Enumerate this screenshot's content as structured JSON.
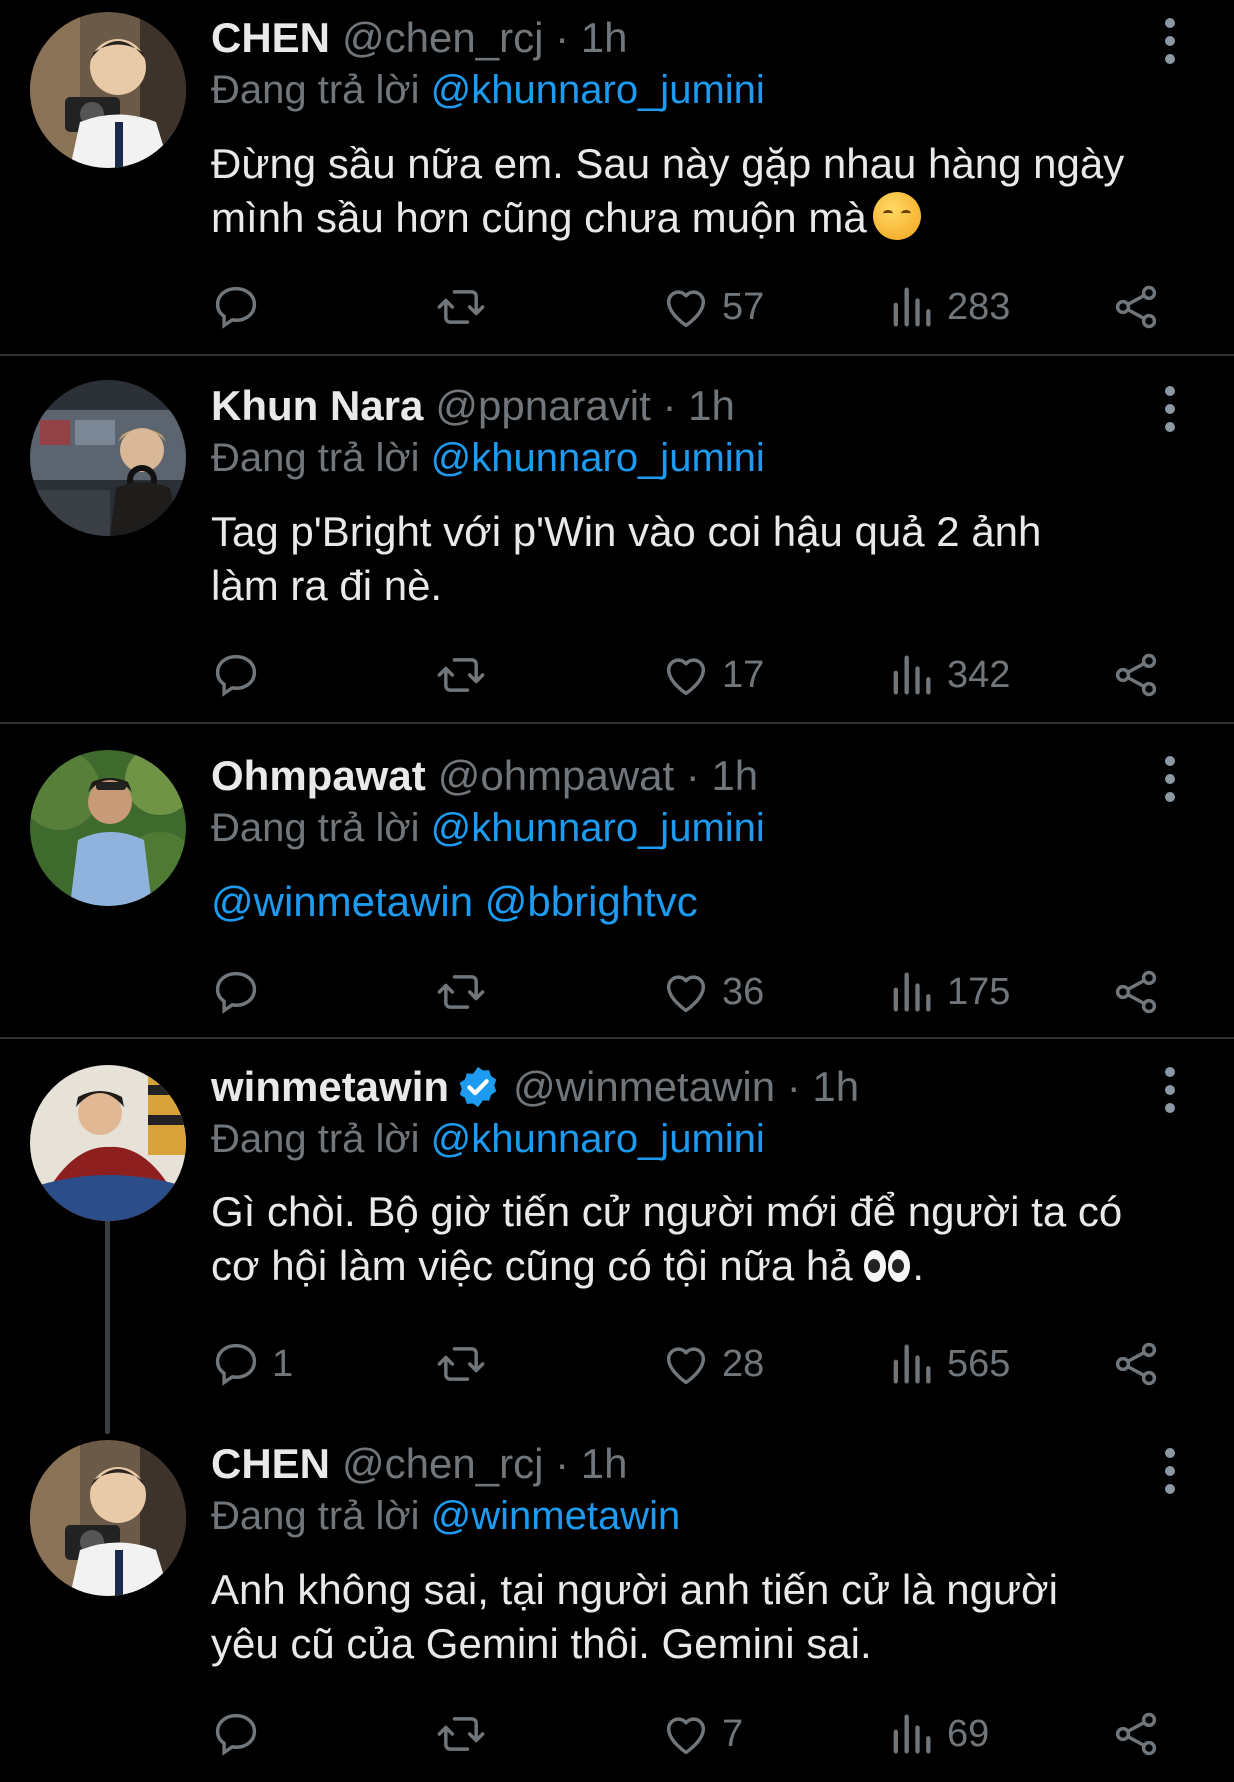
{
  "tweets": [
    {
      "name": "CHEN",
      "handle": "@chen_rcj · 1h",
      "verified": false,
      "reply_prefix": "Đang trả lời ",
      "reply_to": "@khunnaro_jumini",
      "text_line1": "Đừng sầu nữa em. Sau này gặp nhau hàng ngày",
      "text_line2": "mình sầu hơn cũng chưa muộn mà",
      "emoji": "kissing-face-closed-eyes",
      "reply_count": "",
      "like_count": "57",
      "view_count": "283",
      "avatar": "chen-camera-avatar"
    },
    {
      "name": "Khun Nara",
      "handle": "@ppnaravit · 1h",
      "verified": false,
      "reply_prefix": "Đang trả lời ",
      "reply_to": "@khunnaro_jumini",
      "text_line1": "Tag p'Bright với p'Win vào coi hậu quả 2 ảnh",
      "text_line2": "làm ra đi nè.",
      "reply_count": "",
      "like_count": "17",
      "view_count": "342",
      "avatar": "khun-nara-avatar"
    },
    {
      "name": "Ohmpawat",
      "handle": "@ohmpawat · 1h",
      "verified": false,
      "reply_prefix": "Đang trả lời ",
      "reply_to": "@khunnaro_jumini",
      "mention1": "@winmetawin",
      "mention2": "@bbrightvc",
      "reply_count": "",
      "like_count": "36",
      "view_count": "175",
      "avatar": "ohmpawat-avatar"
    },
    {
      "name": "winmetawin",
      "handle": "@winmetawin · 1h",
      "verified": true,
      "reply_prefix": "Đang trả lời ",
      "reply_to": "@khunnaro_jumini",
      "text_line1": "Gì chòi. Bộ giờ tiến cử người mới để người ta có",
      "text_line2": "cơ hội làm việc cũng có tội nữa hả",
      "text_tail": ".",
      "emoji": "eyes",
      "reply_count": "1",
      "like_count": "28",
      "view_count": "565",
      "avatar": "winmetawin-avatar"
    },
    {
      "name": "CHEN",
      "handle": "@chen_rcj · 1h",
      "verified": false,
      "reply_prefix": "Đang trả lời ",
      "reply_to": "@winmetawin",
      "text_line1": "Anh không sai, tại người anh tiến cử là người",
      "text_line2": "yêu cũ của Gemini thôi. Gemini sai.",
      "reply_count": "",
      "like_count": "7",
      "view_count": "69",
      "avatar": "chen-camera-avatar"
    }
  ],
  "colors": {
    "background": "#000000",
    "text": "#e7e9ea",
    "secondary": "#71767b",
    "link": "#1d9bf0",
    "divider": "#2f3336"
  }
}
